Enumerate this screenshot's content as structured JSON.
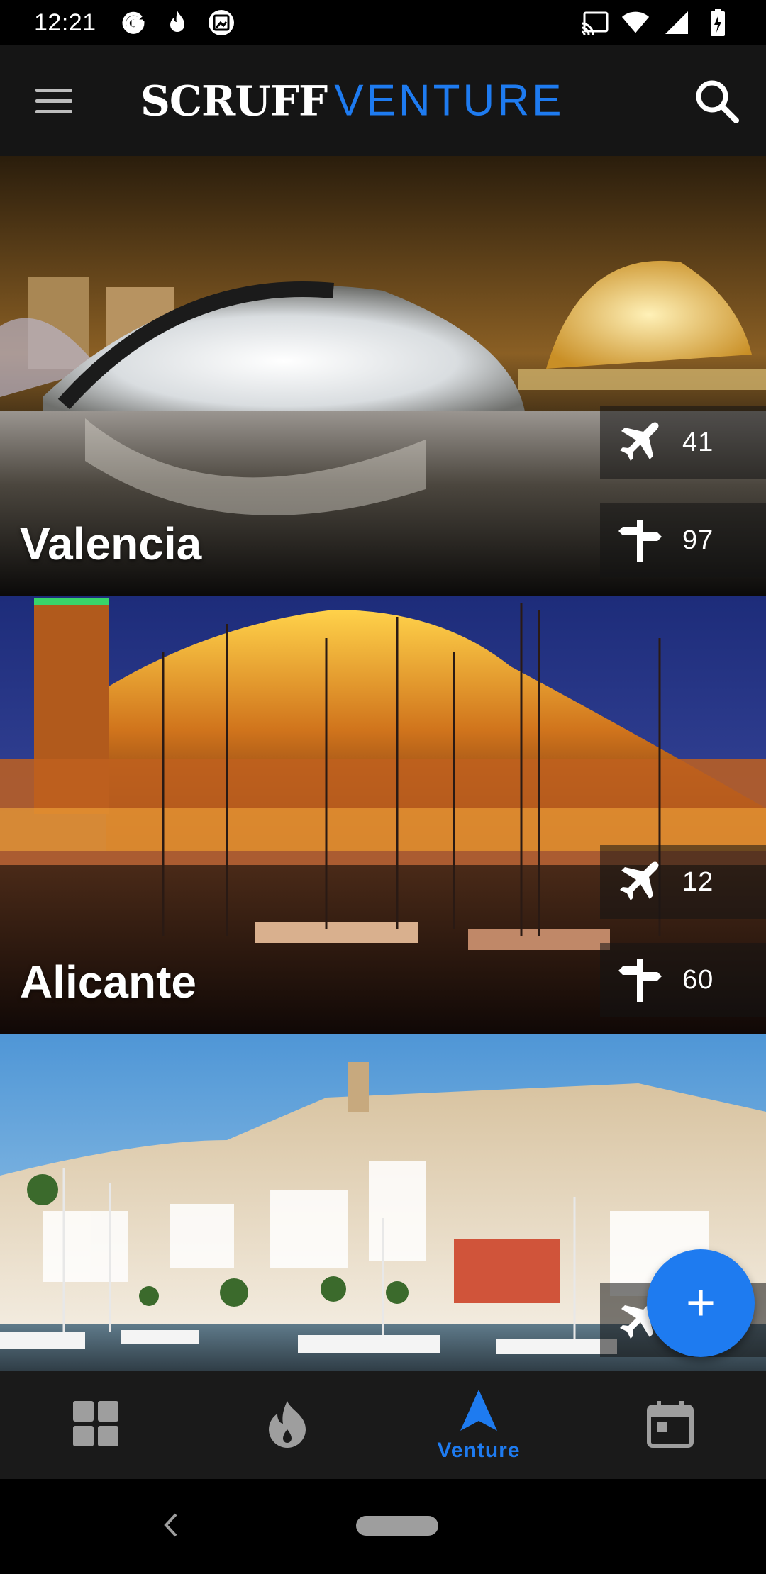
{
  "status_bar": {
    "time": "12:21",
    "left_icons": [
      "google-icon",
      "fire-notification-icon",
      "image-notification-icon"
    ],
    "right_icons": [
      "cast-icon",
      "wifi-icon",
      "cellular-icon",
      "battery-charging-icon"
    ]
  },
  "app_bar": {
    "logo_primary": "SCRUFF",
    "logo_secondary": "VENTURE",
    "menu_icon": "hamburger-menu-icon",
    "search_icon": "search-icon"
  },
  "destinations": [
    {
      "city": "Valencia",
      "arrivals": "41",
      "ambassadors": "97"
    },
    {
      "city": "Alicante",
      "arrivals": "12",
      "ambassadors": "60"
    },
    {
      "city": "",
      "arrivals": "",
      "ambassadors": ""
    }
  ],
  "fab": {
    "label": "+",
    "icon": "plus-icon"
  },
  "bottom_nav": {
    "items": [
      {
        "icon": "grid-icon",
        "label": ""
      },
      {
        "icon": "flame-icon",
        "label": ""
      },
      {
        "icon": "navigation-arrow-icon",
        "label": "Venture",
        "active": true
      },
      {
        "icon": "calendar-icon",
        "label": ""
      }
    ]
  },
  "colors": {
    "accent": "#1e7bf0",
    "app_bar": "#151515",
    "bottom_nav": "#1a1a1a"
  }
}
